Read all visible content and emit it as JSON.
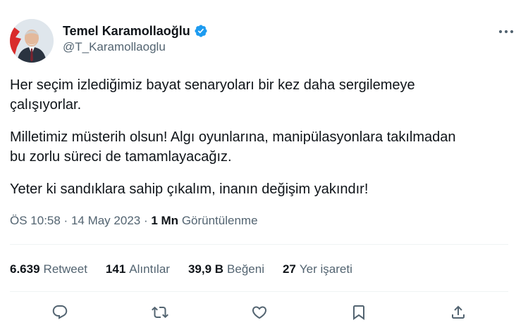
{
  "author": {
    "display_name": "Temel Karamollaoğlu",
    "handle": "@T_Karamollaoglu",
    "verified": true
  },
  "tweet": {
    "paragraphs": [
      "Her seçim izlediğimiz bayat senaryoları bir kez daha sergilemeye\nçalışıyorlar.",
      "Milletimiz müsterih olsun! Algı oyunlarına, manipülasyonlara takılmadan\nbu zorlu süreci de tamamlayacağız.",
      "Yeter ki sandıklara sahip çıkalım, inanın değişim yakındır!"
    ]
  },
  "meta": {
    "time": "ÖS 10:58",
    "separator": " · ",
    "date": "14 May 2023",
    "views_count": "1 Mn",
    "views_label": "Görüntülenme"
  },
  "stats": [
    {
      "count": "6.639",
      "label": "Retweet"
    },
    {
      "count": "141",
      "label": "Alıntılar"
    },
    {
      "count": "39,9 B",
      "label": "Beğeni"
    },
    {
      "count": "27",
      "label": "Yer işareti"
    }
  ],
  "colors": {
    "text_primary": "#0f1419",
    "text_secondary": "#536471",
    "verified_blue": "#1d9bf0",
    "divider": "#eff3f4"
  },
  "icons": {
    "more": "more-horizontal-icon",
    "reply": "reply-icon",
    "retweet": "retweet-icon",
    "like": "heart-icon",
    "bookmark": "bookmark-icon",
    "share": "share-icon"
  }
}
